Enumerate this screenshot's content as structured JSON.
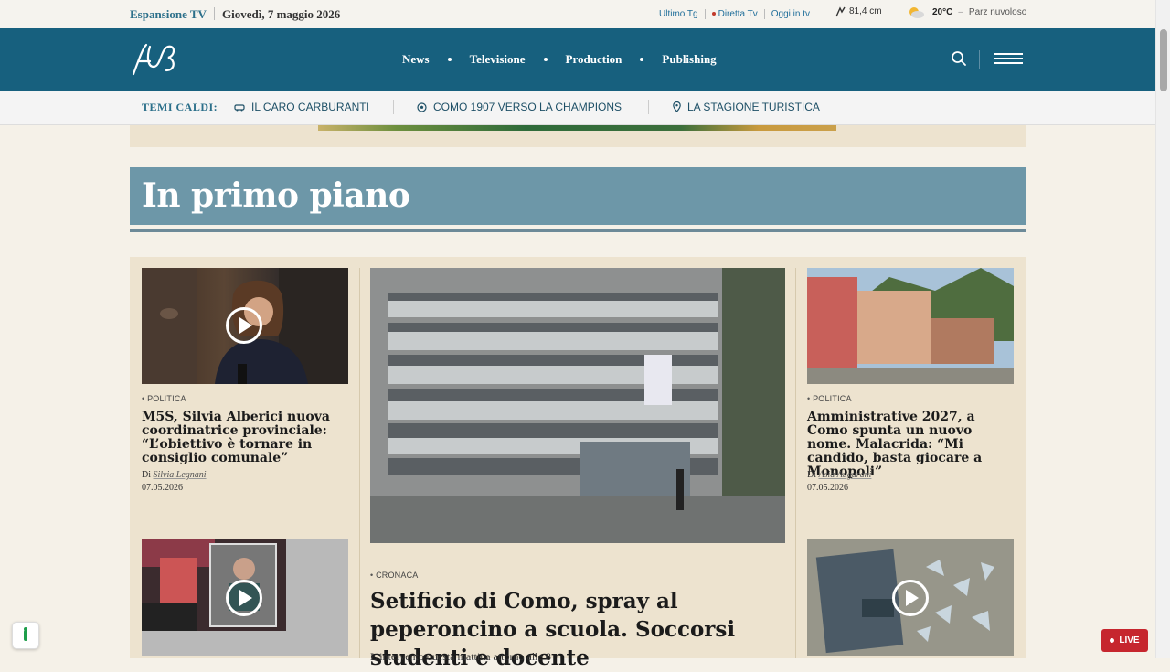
{
  "topbar": {
    "brand": "Espansione TV",
    "date": "Giovedì, 7 maggio 2026",
    "links": [
      "Ultimo Tg",
      "Diretta Tv",
      "Oggi in tv"
    ],
    "lake_level": "81,4 cm",
    "temperature": "20°C",
    "dash": "–",
    "condition": "Parz nuvoloso"
  },
  "nav": {
    "items": [
      "News",
      "Televisione",
      "Production",
      "Publishing"
    ]
  },
  "hot_topics": {
    "label": "TEMI CALDI:",
    "items": [
      "IL CARO CARBURANTI",
      "COMO 1907 VERSO LA CHAMPIONS",
      "LA STAGIONE TURISTICA"
    ]
  },
  "section": {
    "title": "In primo piano"
  },
  "articles": {
    "left1": {
      "category": "POLITICA",
      "title": "M5S, Silvia Alberici nuova coordinatrice provinciale: “L’obiettivo è tornare in consiglio comunale”",
      "by": "Di",
      "author": "Silvia Legnani",
      "date": "07.05.2026"
    },
    "center": {
      "category": "CRONACA",
      "title": "Setificio di Como, spray al peperoncino a scuola. Soccorsi studenti e docente",
      "lead": "L’intervento questa mattina attorno alle 8"
    },
    "right1": {
      "category": "POLITICA",
      "title": "Amministrative 2027, a Como spunta un nuovo nome. Malacrida: “Mi candido, basta giocare a Monopoli”",
      "by": "Di",
      "author": "Asia Augurani",
      "date": "07.05.2026"
    }
  },
  "live": {
    "label": "LIVE"
  },
  "colors": {
    "header": "#17607e",
    "section": "#6d97a8",
    "live": "#c6262e"
  }
}
